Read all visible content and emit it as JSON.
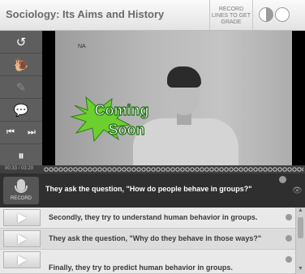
{
  "header": {
    "title": "Sociology: Its Aims and History",
    "record_lines_label": "RECORD LINES TO GET GRADE",
    "grade_icons": [
      "pie-half-icon",
      "empty-circle-icon"
    ]
  },
  "controls": {
    "icons": [
      "replay-icon",
      "snail-icon",
      "translate-icon",
      "chat-icon",
      "previous-icon",
      "next-icon",
      "pause-icon"
    ]
  },
  "video": {
    "corner_tag": "NA",
    "overlay_text_line1": "Coming",
    "overlay_text_line2": "Soon",
    "overlay_color": "#2aa52a"
  },
  "timebar": {
    "elapsed": "00:33",
    "total": "03:20"
  },
  "transcript": {
    "record_label": "RECORD",
    "active_line": "They ask the question, \"How do people behave in groups?\"",
    "lines": [
      "Secondly, they try to understand human behavior in groups.",
      "They ask the question, \"Why do they behave in those ways?\"",
      "Finally, they try to predict human behavior in groups."
    ]
  },
  "colors": {
    "control_bg": "#5e5e5e",
    "active_row_bg": "#2f2f2f"
  }
}
